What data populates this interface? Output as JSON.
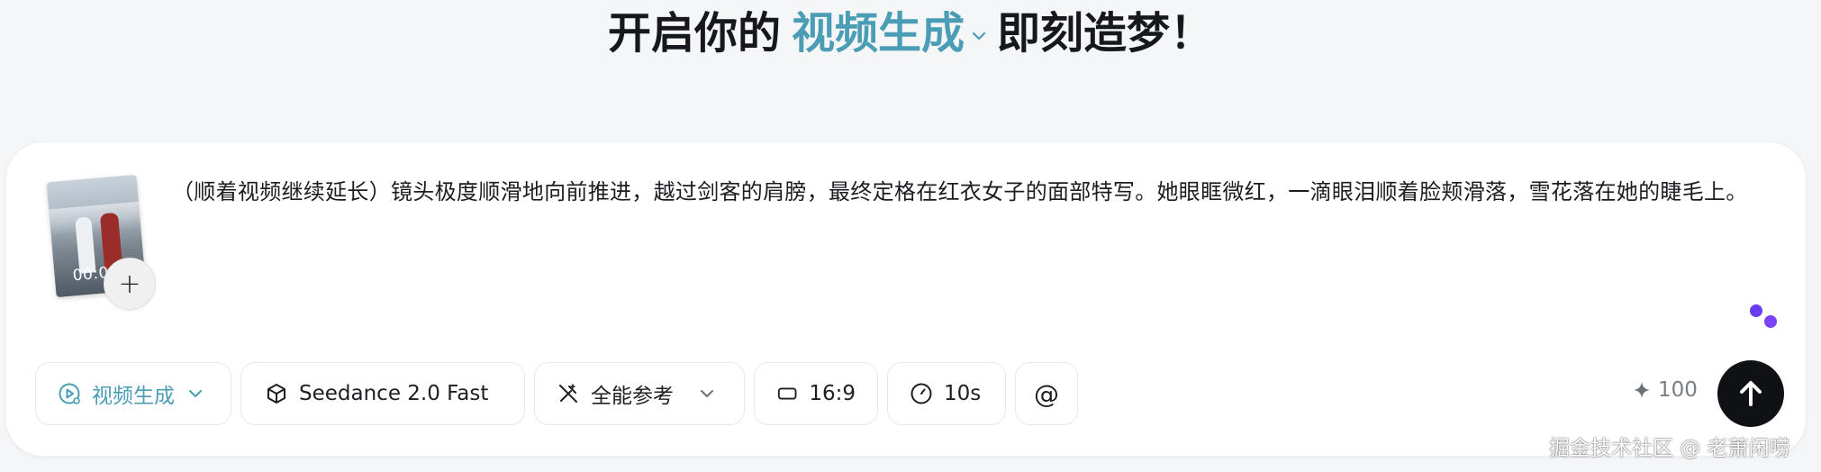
{
  "headline": {
    "prefix": "开启你的",
    "mode": "视频生成",
    "suffix": "即刻造梦！"
  },
  "attachment": {
    "thumbnail_time": "00:0",
    "add_label": "+"
  },
  "prompt": {
    "text": "（顺着视频继续延长）镜头极度顺滑地向前推进，越过剑客的肩膀，最终定格在红衣女子的面部特写。她眼眶微红，一滴眼泪顺着脸颊滑落，雪花落在她的睫毛上。"
  },
  "toolbar": {
    "mode_label": "视频生成",
    "model_label": "Seedance 2.0 Fast",
    "reference_label": "全能参考",
    "ratio_label": "16:9",
    "duration_label": "10s",
    "mention_label": "@"
  },
  "credits": {
    "value": "100"
  },
  "watermark": {
    "text": "掘金技术社区 @ 老萧闲唠"
  },
  "colors": {
    "accent": "#4a9db4",
    "send": "#101114",
    "dots": "#6b3df0"
  }
}
